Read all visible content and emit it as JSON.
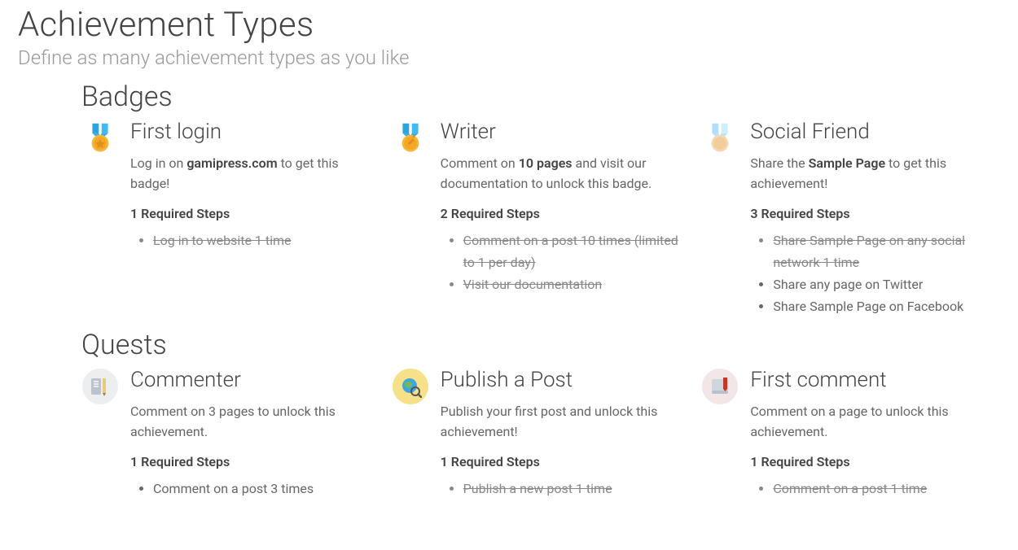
{
  "title": "Achievement Types",
  "subtitle": "Define as many achievement types as you like",
  "sections": [
    {
      "title": "Badges",
      "items": [
        {
          "icon": "medal-gold-star",
          "title": "First login",
          "desc": [
            {
              "t": "Log in on "
            },
            {
              "t": "gamipress.com",
              "bold": true
            },
            {
              "t": " to get this badge!"
            }
          ],
          "req_label": "1 Required Steps",
          "steps": [
            {
              "text": "Log in to website 1 time",
              "done": true
            }
          ]
        },
        {
          "icon": "medal-gold-pencil",
          "title": "Writer",
          "desc": [
            {
              "t": "Comment on "
            },
            {
              "t": "10 pages",
              "bold": true
            },
            {
              "t": " and visit our documentation to unlock this badge."
            }
          ],
          "req_label": "2 Required Steps",
          "steps": [
            {
              "text": "Comment on a post 10 times (limited to 1 per day)",
              "done": true
            },
            {
              "text": "Visit our documentation",
              "done": true
            }
          ]
        },
        {
          "icon": "medal-light",
          "title": "Social Friend",
          "desc": [
            {
              "t": "Share the "
            },
            {
              "t": "Sample Page",
              "bold": true
            },
            {
              "t": " to get this achievement!"
            }
          ],
          "req_label": "3 Required Steps",
          "steps": [
            {
              "text": "Share Sample Page on any social network 1 time",
              "done": true
            },
            {
              "text": "Share any page on Twitter",
              "done": false
            },
            {
              "text": "Share Sample Page on Facebook",
              "done": false
            }
          ]
        }
      ]
    },
    {
      "title": "Quests",
      "items": [
        {
          "icon": "quest-commenter",
          "title": "Commenter",
          "desc": [
            {
              "t": "Comment on 3 pages to unlock this achievement."
            }
          ],
          "req_label": "1 Required Steps",
          "steps": [
            {
              "text": "Comment on a post 3 times",
              "done": false
            }
          ]
        },
        {
          "icon": "quest-globe",
          "title": "Publish a Post",
          "desc": [
            {
              "t": "Publish your first post and unlock this achievement!"
            }
          ],
          "req_label": "1 Required Steps",
          "steps": [
            {
              "text": "Publish a new post 1 time",
              "done": true
            }
          ]
        },
        {
          "icon": "quest-book",
          "title": "First comment",
          "desc": [
            {
              "t": "Comment on a page to unlock this achievement."
            }
          ],
          "req_label": "1 Required Steps",
          "steps": [
            {
              "text": "Comment on a post 1 time",
              "done": true
            }
          ]
        }
      ]
    }
  ]
}
